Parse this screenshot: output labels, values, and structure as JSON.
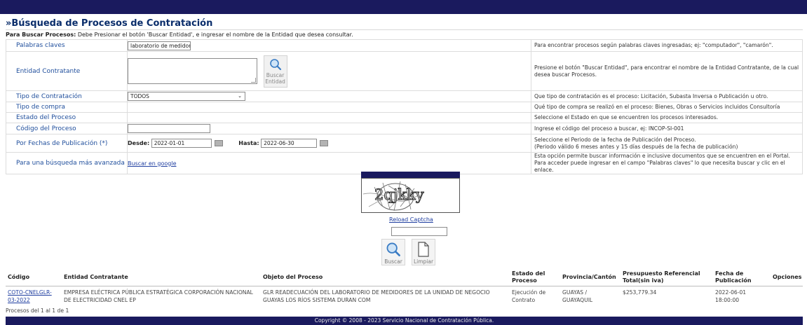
{
  "header": {
    "title": "»Búsqueda de Procesos de Contratación",
    "instructions_bold": "Para Buscar Procesos:",
    "instructions_text": " Debe Presionar el botón 'Buscar Entidad', e ingresar el nombre de la Entidad que desea consultar."
  },
  "form": {
    "keywords": {
      "label": "Palabras claves",
      "value": "laboratorio de medidores",
      "help": "Para encontrar procesos según palabras claves ingresadas; ej: \"computador\", \"camarón\"."
    },
    "entity": {
      "label": "Entidad Contratante",
      "value": "",
      "button_line1": "Buscar",
      "button_line2": "Entidad",
      "help": "Presione el botón \"Buscar Entidad\", para encontrar el nombre de la Entidad Contratante, de la cual desea buscar Procesos."
    },
    "contract_type": {
      "label": "Tipo de Contratación",
      "selected": "TODOS",
      "help": "Que tipo de contratación es el proceso: Licitación, Subasta Inversa o Publicación u otro."
    },
    "purchase_type": {
      "label": "Tipo de compra",
      "help": "Qué tipo de compra se realizó en el proceso: Bienes, Obras o Servicios incluidos Consultoría"
    },
    "process_state": {
      "label": "Estado del Proceso",
      "help": "Seleccione el Estado en que se encuentren los procesos interesados."
    },
    "process_code": {
      "label": "Código del Proceso",
      "value": "",
      "help": "Ingrese el código del proceso a buscar, ej: INCOP-SI-001"
    },
    "dates": {
      "label": "Por Fechas de Publicación (*)",
      "from_label": "Desde:",
      "from_value": "2022-01-01",
      "to_label": "Hasta:",
      "to_value": "2022-06-30",
      "help_line1": "Seleccione el Periodo de la fecha de Publicación del Proceso.",
      "help_line2": "(Periodo válido 6 meses antes y 15 días después de la fecha de publicación)"
    },
    "advanced": {
      "label": "Para una búsqueda más avanzada",
      "link": "Buscar en google",
      "help": "Esta opción permite buscar información e inclusive documentos que se encuentren en el Portal. Para acceder puede ingresar en el campo \"Palabras claves\" lo que necesita buscar y clic en el enlace."
    }
  },
  "captcha": {
    "text": "2qjkky",
    "reload_label": "Reload Captcha",
    "input_value": ""
  },
  "actions": {
    "search_label": "Buscar",
    "clear_label": "Limpiar"
  },
  "results": {
    "headers": {
      "code": "Código",
      "entity": "Entidad Contratante",
      "object": "Objeto del Proceso",
      "state": "Estado del Proceso",
      "province": "Provincia/Cantón",
      "budget": "Presupuesto Referencial Total(sin iva)",
      "date": "Fecha de Publicación",
      "options": "Opciones"
    },
    "rows": [
      {
        "code": "COTO-CNELGLR-03-2022",
        "entity": "EMPRESA ELÉCTRICA PÚBLICA ESTRATÉGICA CORPORACIÓN NACIONAL DE ELECTRICIDAD CNEL EP",
        "object": "GLR READECUACIÓN DEL LABORATORIO DE MEDIDORES DE LA UNIDAD DE NEGOCIO GUAYAS LOS RÍOS SISTEMA DURAN COM",
        "state": "Ejecución de Contrato",
        "province": "GUAYAS / GUAYAQUIL",
        "budget": "$253,779.34",
        "date": "2022-06-01 18:00:00"
      }
    ],
    "count": "Procesos del 1 al 1 de 1"
  },
  "footer": {
    "copyright": "Copyright © 2008 - 2023 Servicio Nacional de Contratación Pública."
  },
  "colors": {
    "navy": "#1a1a5e",
    "label_blue": "#1f4e9c",
    "title_blue": "#0a2d6b"
  }
}
